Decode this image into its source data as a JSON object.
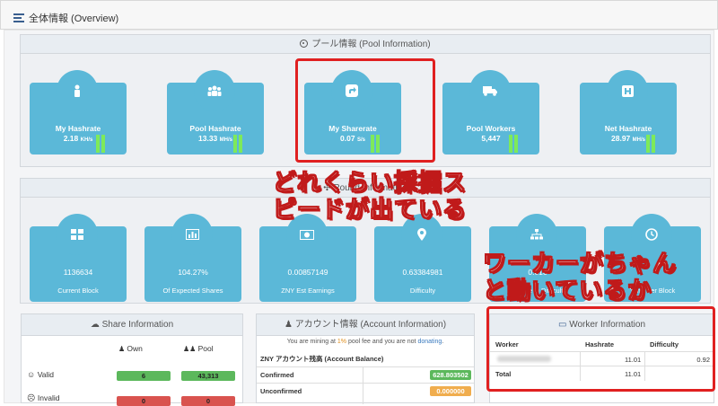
{
  "header": {
    "title": "全体情報 (Overview)"
  },
  "pool": {
    "title": "プール情報 (Pool Information)",
    "cards": [
      {
        "label": "My Hashrate",
        "value": "2.18",
        "unit": "KH/s"
      },
      {
        "label": "Pool Hashrate",
        "value": "13.33",
        "unit": "MH/s"
      },
      {
        "label": "My Sharerate",
        "value": "0.07",
        "unit": "S/s"
      },
      {
        "label": "Pool Workers",
        "value": "5,447",
        "unit": ""
      },
      {
        "label": "Net Hashrate",
        "value": "28.97",
        "unit": "MH/s"
      }
    ]
  },
  "round": {
    "title": "Round Information",
    "cards": [
      {
        "value": "1136634",
        "label": "Current Block"
      },
      {
        "value": "104.27%",
        "label": "Of Expected Shares"
      },
      {
        "value": "0.00857149",
        "label": "ZNY Est Earnings"
      },
      {
        "value": "0.63384981",
        "label": "Difficulty"
      },
      {
        "value": "0.616",
        "label": "Change in Difficulty"
      },
      {
        "value": "",
        "label": "Time Per Block"
      }
    ]
  },
  "annotations": {
    "speed": [
      "どれくらい採掘ス",
      "ピードが出ている"
    ],
    "workers": [
      "ワーカーがちゃん",
      "と動いているか"
    ]
  },
  "share": {
    "title": "Share Information",
    "col_own": "Own",
    "col_pool": "Pool",
    "rows": [
      {
        "label": "Valid",
        "own": "6",
        "pool": "43,313"
      },
      {
        "label": "Invalid",
        "own": "0",
        "pool": "0"
      }
    ]
  },
  "account": {
    "title": "アカウント情報 (Account Information)",
    "note_pre": "You are mining at ",
    "fee": "1%",
    "note_mid": " pool fee and you are not ",
    "donating": "donating",
    "balance_title": "ZNY アカウント残高 (Account Balance)",
    "confirmed_label": "Confirmed",
    "confirmed_value": "628.803502",
    "unconfirmed_label": "Unconfirmed",
    "unconfirmed_value": "0.000000"
  },
  "worker": {
    "title": "Worker Information",
    "cols": [
      "Worker",
      "Hashrate",
      "Difficulty"
    ],
    "rows": [
      {
        "worker": "",
        "hashrate": "11.01",
        "difficulty": "0.92"
      }
    ],
    "total_label": "Total",
    "total_hashrate": "11.01"
  },
  "colors": {
    "card": "#5bb8d8",
    "accent_red": "#e02020",
    "bar_green": "#7eea5a",
    "badge_green": "#5cb85c",
    "badge_orange": "#f0ad4e",
    "badge_red": "#d9534f"
  }
}
